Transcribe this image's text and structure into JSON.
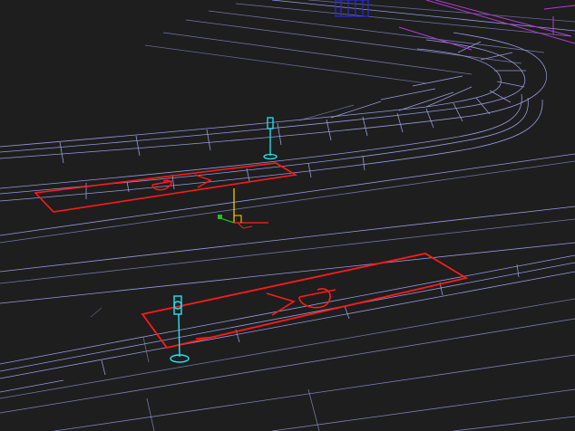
{
  "viewport": {
    "background": "#1e1e1e",
    "mesh_color": "#aab0ff",
    "mesh_color_dim": "#8f86d8",
    "parking_outline_color": "#ff1a1a",
    "signpost_color": "#22e6f0",
    "purple_prop_color": "#b23cd0",
    "blue_prop_color": "#2a2ad8"
  },
  "parking_zone_top": {
    "icon": "parking-space-icon",
    "marking_text": "P<"
  },
  "parking_zone_bottom": {
    "icon": "parking-space-icon",
    "marking_text": "P<"
  },
  "gizmo": {
    "icon": "transform-gizmo-icon",
    "z_axis_color": "#ffd400",
    "x_axis_color": "#ff2020",
    "y_axis_color": "#20c020"
  }
}
